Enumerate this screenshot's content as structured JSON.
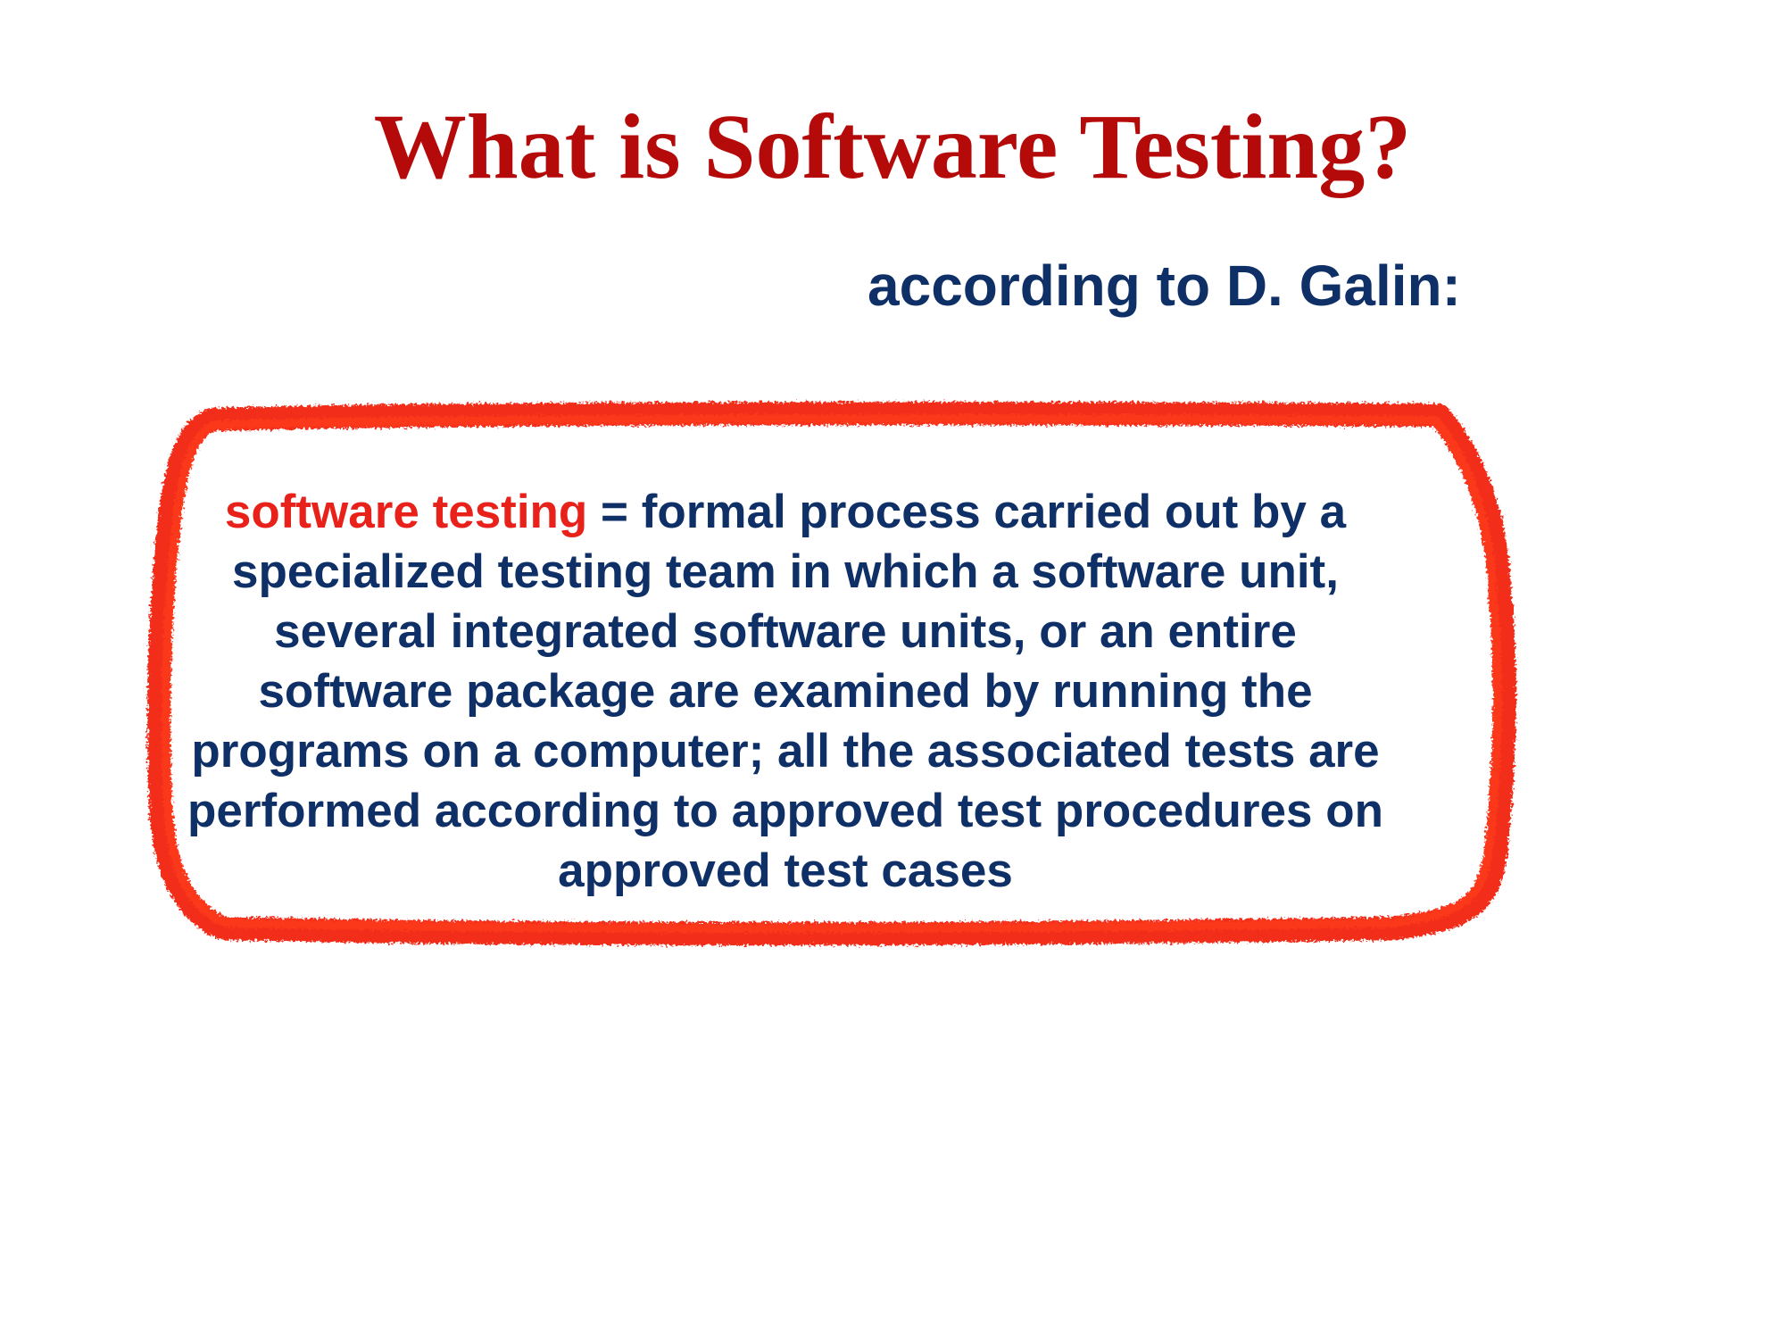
{
  "slide": {
    "title": "What is Software Testing?",
    "subtitle": "according to D. Galin:",
    "definition": {
      "term": "software testing",
      "text": " = formal process carried out by a specialized testing team in which a software unit, several integrated software units, or an entire software package are examined by running the programs on a computer; all the associated tests are performed according to approved test procedures on approved test cases"
    }
  },
  "colors": {
    "title": "#b50a0a",
    "body_text": "#0f2f67",
    "term_highlight": "#e8221b",
    "frame_stroke": "#f2200f"
  }
}
